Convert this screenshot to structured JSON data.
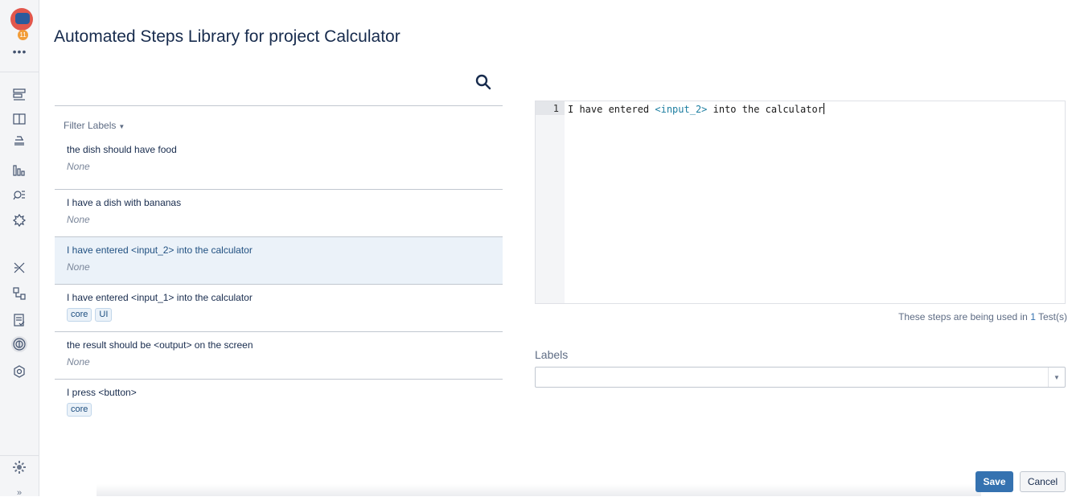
{
  "sidebar": {
    "badge": "11",
    "more": "•••",
    "expand": "»"
  },
  "page": {
    "title": "Automated Steps Library for project Calculator"
  },
  "filter": {
    "label": "Filter Labels",
    "caret": "▼"
  },
  "steps": [
    {
      "title": "the dish should have food",
      "labels_text": "None",
      "tags": []
    },
    {
      "title": "I have a dish with bananas",
      "labels_text": "None",
      "tags": []
    },
    {
      "title": "I have entered <input_2> into the calculator",
      "labels_text": "None",
      "tags": [],
      "selected": true
    },
    {
      "title": "I have entered <input_1> into the calculator",
      "labels_text": "",
      "tags": [
        "core",
        "UI"
      ]
    },
    {
      "title": "the result should be <output> on the screen",
      "labels_text": "None",
      "tags": []
    },
    {
      "title": "I press <button>",
      "labels_text": "",
      "tags": [
        "core"
      ]
    }
  ],
  "editor": {
    "line_number": "1",
    "code_prefix": "I have entered ",
    "code_param": "<input_2>",
    "code_suffix": " into the calculator"
  },
  "usage": {
    "prefix": "These steps are being used in ",
    "count": "1",
    "suffix": " Test(s)"
  },
  "labels_field": {
    "title": "Labels",
    "value": ""
  },
  "actions": {
    "save": "Save",
    "cancel": "Cancel"
  },
  "colors": {
    "primary": "#3572b0",
    "selected_bg": "#ebf2f9",
    "param": "#1e7fa1"
  }
}
